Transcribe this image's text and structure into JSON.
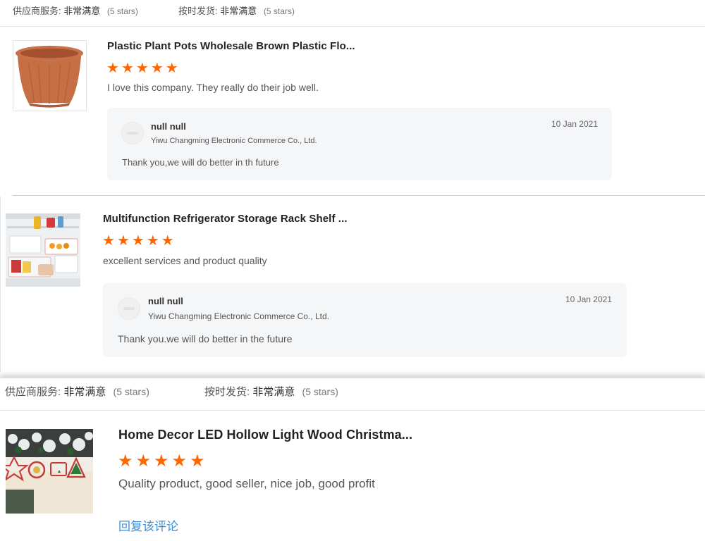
{
  "top_rating": {
    "service_label": "供应商服务:",
    "service_value": "非常满意",
    "service_count": "(5 stars)",
    "shipping_label": "按时发货:",
    "shipping_value": "非常满意",
    "shipping_count": "(5 stars)"
  },
  "reviews": [
    {
      "title": "Plastic Plant Pots Wholesale Brown Plastic Flo...",
      "rating": 5,
      "comment": "I love this company. They really do their job well.",
      "reply": {
        "name": "null null",
        "company": "Yiwu Changming Electronic Commerce Co., Ltd.",
        "date": "10 Jan 2021",
        "text": "Thank you,we will do better in th future"
      }
    },
    {
      "title": "Multifunction Refrigerator Storage Rack Shelf ...",
      "rating": 5,
      "comment": "excellent services and product quality",
      "reply": {
        "name": "null null",
        "company": "Yiwu Changming Electronic Commerce Co., Ltd.",
        "date": "10 Jan 2021",
        "text": "Thank you.we will do better in the future"
      }
    }
  ],
  "bottom_rating": {
    "service_label": "供应商服务:",
    "service_value": "非常满意",
    "service_count": "(5 stars)",
    "shipping_label": "按时发货:",
    "shipping_value": "非常满意",
    "shipping_count": "(5 stars)"
  },
  "bottom_review": {
    "title": "Home Decor LED Hollow Light Wood Christma...",
    "rating": 5,
    "comment": "Quality product, good seller, nice job, good profit",
    "reply_link": "回复该评论"
  },
  "colors": {
    "star": "#ff6600",
    "link": "#3b8fd6",
    "reply_bg": "#f5f6f8"
  },
  "icons": {
    "star": "star-icon",
    "avatar": "avatar-icon"
  }
}
